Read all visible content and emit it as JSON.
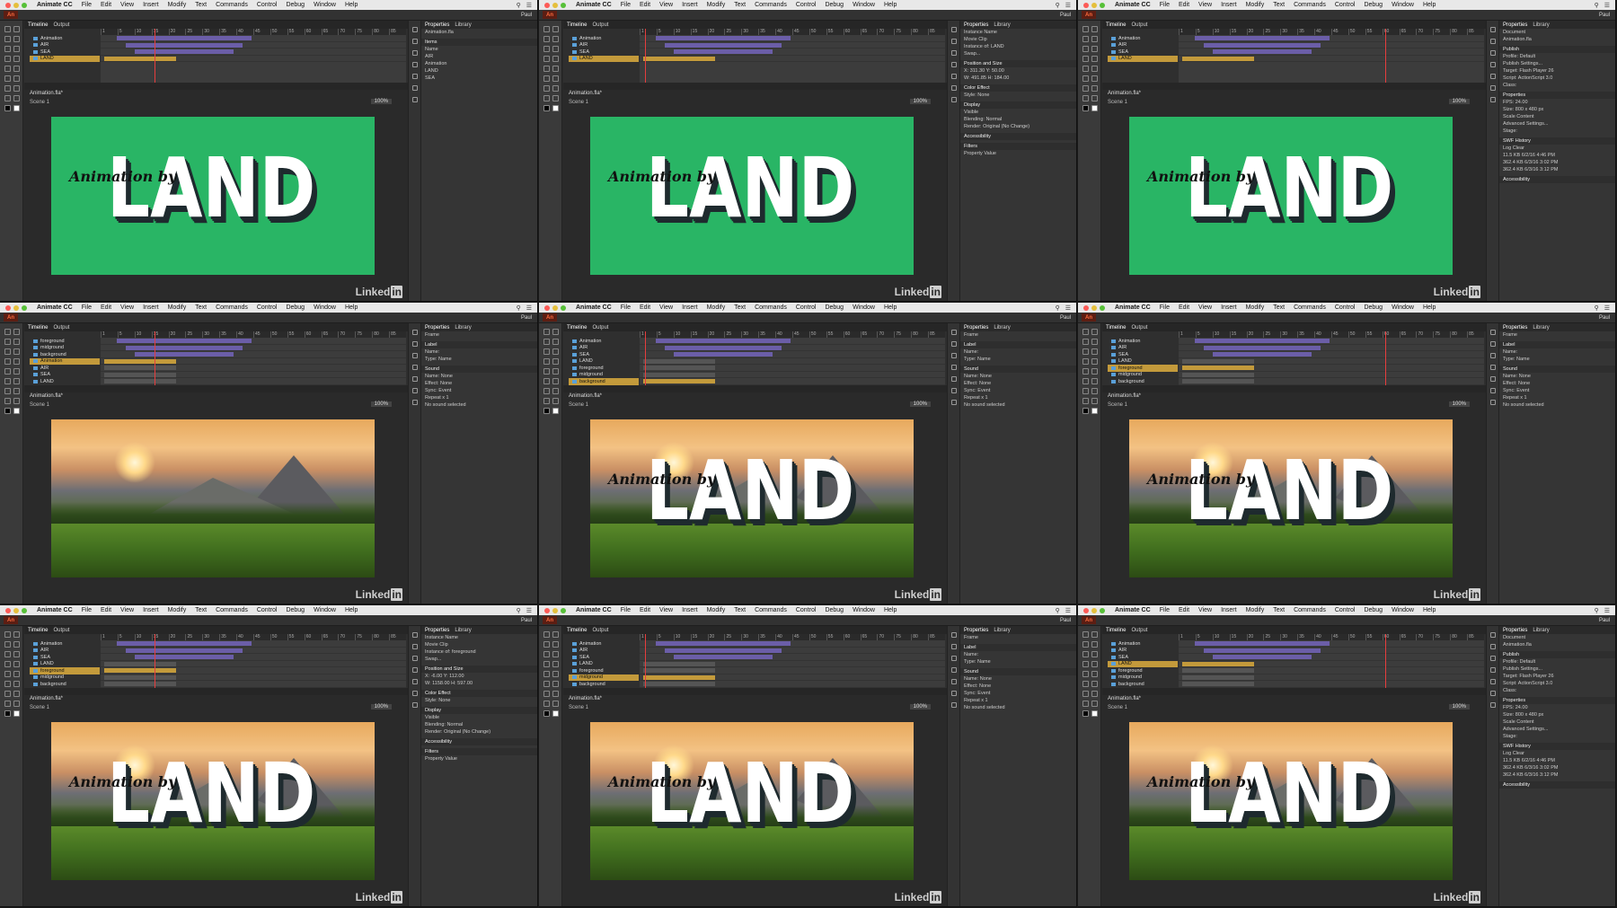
{
  "app": {
    "name": "Animate CC",
    "menus": [
      "File",
      "Edit",
      "View",
      "Insert",
      "Modify",
      "Text",
      "Commands",
      "Control",
      "Debug",
      "Window",
      "Help"
    ],
    "logo": "An",
    "workspace": "Paul"
  },
  "panels": {
    "timeline_tab": "Timeline",
    "output_tab": "Output",
    "properties_tab": "Properties",
    "library_tab": "Library",
    "breadcrumb": "Animation.fla*",
    "scene": "Scene 1",
    "zoom": "100%",
    "ruler_ticks": [
      "1",
      "5",
      "10",
      "15",
      "20",
      "25",
      "30",
      "35",
      "40",
      "45",
      "50",
      "55",
      "60",
      "65",
      "70",
      "75",
      "80",
      "85"
    ]
  },
  "stage": {
    "title": "LAND",
    "byline": "Animation by"
  },
  "watermark": "Linked",
  "watermark_in": "in",
  "tiles": [
    {
      "bg": "green",
      "layers": [
        "Animation",
        "AIR",
        "SEA",
        "LAND"
      ],
      "selected": 3,
      "panel_rows": [
        "Animation.fla",
        "Items",
        "Name",
        "AIR",
        "Animation",
        "LAND",
        "SEA"
      ],
      "show_land": true
    },
    {
      "bg": "green",
      "layers": [
        "Animation",
        "AIR",
        "SEA",
        "LAND"
      ],
      "selected": 3,
      "panel_rows": [
        "Instance Name",
        "Movie Clip",
        "Instance of: LAND",
        "Swap...",
        "Position and Size",
        "X: 311.30  Y: 50.00",
        "W: 491.85  H: 184.00",
        "Color Effect",
        "Style: None",
        "Display",
        "Visible",
        "Blending: Normal",
        "Render: Original (No Change)",
        "Accessibility",
        "Filters",
        "Property  Value"
      ],
      "show_land": true
    },
    {
      "bg": "green",
      "layers": [
        "Animation",
        "AIR",
        "SEA",
        "LAND"
      ],
      "selected": 3,
      "panel_rows": [
        "Document",
        "Animation.fla",
        "Publish",
        "Profile: Default",
        "Publish Settings...",
        "Target: Flash Player 26",
        "Script: ActionScript 3.0",
        "Class:",
        "Properties",
        "FPS: 24.00",
        "Size: 800 x 480  px",
        "Scale Content",
        "Advanced Settings...",
        "Stage:",
        "SWF History",
        "Log  Clear",
        "11.5 KB  6/2/16  4:46 PM",
        "362.4 KB  6/3/16  3:02 PM",
        "362.4 KB  6/3/16  3:12 PM",
        "Accessibility"
      ],
      "show_land": true
    },
    {
      "bg": "photo",
      "layers": [
        "foreground",
        "midground",
        "background",
        "Animation",
        "AIR",
        "SEA",
        "LAND"
      ],
      "selected": 3,
      "panel_rows": [
        "Frame",
        "Label",
        "Name:",
        "Type: Name",
        "Sound",
        "Name: None",
        "Effect: None",
        "Sync: Event",
        "Repeat  x 1",
        "No sound selected"
      ],
      "show_land": false
    },
    {
      "bg": "photo",
      "layers": [
        "Animation",
        "AIR",
        "SEA",
        "LAND",
        "foreground",
        "midground",
        "background"
      ],
      "selected": 6,
      "panel_rows": [
        "Frame",
        "Label",
        "Name:",
        "Type: Name",
        "Sound",
        "Name: None",
        "Effect: None",
        "Sync: Event",
        "Repeat  x 1",
        "No sound selected"
      ],
      "show_land": true
    },
    {
      "bg": "photo",
      "layers": [
        "Animation",
        "AIR",
        "SEA",
        "LAND",
        "foreground",
        "midground",
        "background"
      ],
      "selected": 4,
      "panel_rows": [
        "Frame",
        "Label",
        "Name:",
        "Type: Name",
        "Sound",
        "Name: None",
        "Effect: None",
        "Sync: Event",
        "Repeat  x 1",
        "No sound selected"
      ],
      "show_land": true
    },
    {
      "bg": "photo",
      "layers": [
        "Animation",
        "AIR",
        "SEA",
        "LAND",
        "foreground",
        "midground",
        "background"
      ],
      "selected": 4,
      "panel_rows": [
        "Instance Name",
        "Movie Clip",
        "Instance of: foreground",
        "Swap...",
        "Position and Size",
        "X: -6.00  Y: 112.00",
        "W: 1158.00  H: 597.00",
        "Color Effect",
        "Style: None",
        "Display",
        "Visible",
        "Blending: Normal",
        "Render: Original (No Change)",
        "Accessibility",
        "Filters",
        "Property  Value"
      ],
      "show_land": true
    },
    {
      "bg": "photo",
      "layers": [
        "Animation",
        "AIR",
        "SEA",
        "LAND",
        "foreground",
        "midground",
        "background"
      ],
      "selected": 5,
      "panel_rows": [
        "Frame",
        "Label",
        "Name:",
        "Type: Name",
        "Sound",
        "Name: None",
        "Effect: None",
        "Sync: Event",
        "Repeat  x 1",
        "No sound selected"
      ],
      "show_land": true
    },
    {
      "bg": "photo",
      "layers": [
        "Animation",
        "AIR",
        "SEA",
        "LAND",
        "foreground",
        "midground",
        "background"
      ],
      "selected": 3,
      "panel_rows": [
        "Document",
        "Animation.fla",
        "Publish",
        "Profile: Default",
        "Publish Settings...",
        "Target: Flash Player 26",
        "Script: ActionScript 3.0",
        "Class:",
        "Properties",
        "FPS: 24.00",
        "Size: 800 x 480  px",
        "Scale Content",
        "Advanced Settings...",
        "Stage:",
        "SWF History",
        "Log  Clear",
        "11.5 KB  6/2/16  4:46 PM",
        "362.4 KB  6/3/16  3:02 PM",
        "362.4 KB  6/3/16  3:12 PM",
        "Accessibility"
      ],
      "show_land": true
    }
  ]
}
